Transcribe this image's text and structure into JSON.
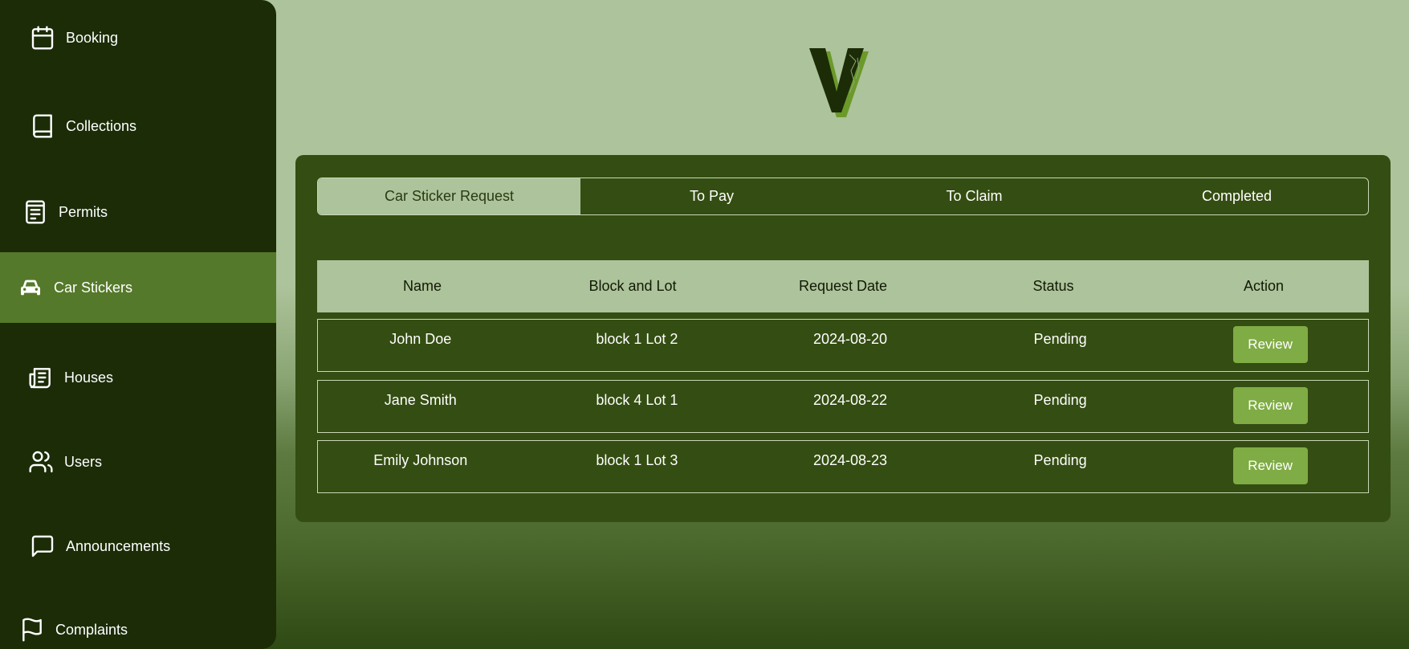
{
  "sidebar": {
    "items": [
      {
        "label": "Booking",
        "icon": "calendar-icon"
      },
      {
        "label": "Collections",
        "icon": "book-icon"
      },
      {
        "label": "Permits",
        "icon": "document-icon"
      },
      {
        "label": "Car Stickers",
        "icon": "car-icon",
        "active": true
      },
      {
        "label": "Houses",
        "icon": "newspaper-icon"
      },
      {
        "label": "Users",
        "icon": "users-icon"
      },
      {
        "label": "Announcements",
        "icon": "message-square-icon"
      },
      {
        "label": "Complaints",
        "icon": "flag-icon"
      }
    ]
  },
  "tabs": [
    {
      "label": "Car Sticker Request",
      "active": true
    },
    {
      "label": "To Pay"
    },
    {
      "label": "To Claim"
    },
    {
      "label": "Completed"
    }
  ],
  "table": {
    "headers": [
      "Name",
      "Block and Lot",
      "Request Date",
      "Status",
      "Action"
    ],
    "rows": [
      {
        "name": "John Doe",
        "block_lot": "block 1 Lot 2",
        "date": "2024-08-20",
        "status": "Pending",
        "action": "Review"
      },
      {
        "name": "Jane Smith",
        "block_lot": "block 4 Lot 1",
        "date": "2024-08-22",
        "status": "Pending",
        "action": "Review"
      },
      {
        "name": "Emily Johnson",
        "block_lot": "block 1 Lot 3",
        "date": "2024-08-23",
        "status": "Pending",
        "action": "Review"
      }
    ]
  },
  "colors": {
    "sidebar_bg": "#1b2c07",
    "active_item": "#55792a",
    "panel_bg": "#344d12",
    "header_bg": "#adc39b",
    "button": "#7fac44"
  }
}
